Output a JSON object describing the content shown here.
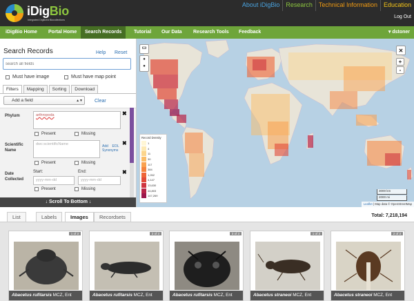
{
  "brand": {
    "name_white": "iDig",
    "name_green": "Bio",
    "tagline": "Integrated Digitized Biocollections"
  },
  "toplinks": [
    {
      "label": "About iDigBio",
      "color": "#4aa3df"
    },
    {
      "label": "Research",
      "color": "#8dc63f"
    },
    {
      "label": "Technical Information",
      "color": "#f39c12"
    },
    {
      "label": "Education",
      "color": "#f5c518"
    }
  ],
  "logout": "Log Out",
  "nav": {
    "items": [
      "iDigBio Home",
      "Portal Home",
      "Search Records",
      "Tutorial",
      "Our Data",
      "Research Tools",
      "Feedback"
    ],
    "active": "Search Records",
    "user": "▾ dstoner"
  },
  "search": {
    "title": "Search Records",
    "help": "Help",
    "reset": "Reset",
    "all_fields_placeholder": "search all fields",
    "must_have_image": "Must have image",
    "must_have_map_point": "Must have map point",
    "tabs": [
      "Filters",
      "Mapping",
      "Sorting",
      "Download"
    ],
    "active_tab": "Filters",
    "add_field": "Add a field",
    "clear": "Clear",
    "phylum": {
      "label": "Phylum",
      "value": "arthropoda",
      "present": "Present",
      "missing": "Missing"
    },
    "sci_name": {
      "label_1": "Scientific",
      "label_2": "Name",
      "placeholder": "dwc:scientificName",
      "add": "Add",
      "eol": "EOL",
      "synonyms": "Synonyms",
      "present": "Present",
      "missing": "Missing"
    },
    "date": {
      "label_1": "Date",
      "label_2": "Collected",
      "start": "Start:",
      "end": "End:",
      "placeholder": "yyyy-mm-dd",
      "present": "Present",
      "missing": "Missing"
    },
    "scroll_bottom": "↓ Scroll To Bottom ↓"
  },
  "map": {
    "zoom_in": "+",
    "zoom_out": "-",
    "close": "✕",
    "legend_title": "Record Density",
    "legend": [
      {
        "label": "1",
        "color": "#fff6d5"
      },
      {
        "label": "4",
        "color": "#fde9b3"
      },
      {
        "label": "11",
        "color": "#fcd58c"
      },
      {
        "label": "30",
        "color": "#fbbd68"
      },
      {
        "label": "117",
        "color": "#f9a14f"
      },
      {
        "label": "384",
        "color": "#f5833e"
      },
      {
        "label": "1,262",
        "color": "#ee6437"
      },
      {
        "label": "4,147",
        "color": "#e14a39"
      },
      {
        "label": "13,630",
        "color": "#cf3540"
      },
      {
        "label": "44,803",
        "color": "#b82548"
      },
      {
        "label": "147,269",
        "color": "#9c184c"
      }
    ],
    "scale_km": "3000 km",
    "scale_mi": "2000 mi",
    "leaflet": "Leaflet",
    "attribution": " | Map data © OpenStreetMap"
  },
  "results": {
    "tabs": [
      "List",
      "Labels",
      "Images",
      "Recordsets"
    ],
    "active_tab": "Images",
    "total": "Total: 7,218,194",
    "cards": [
      {
        "badge": "1 of 3",
        "species": "Abacetus rufitarsis",
        "inst": "MCZ, Ent"
      },
      {
        "badge": "2 of 3",
        "species": "Abacetus rufitarsis",
        "inst": "MCZ, Ent"
      },
      {
        "badge": "3 of 3",
        "species": "Abacetus rufitarsis",
        "inst": "MCZ, Ent"
      },
      {
        "badge": "1 of 3",
        "species": "Abacetus straneoi",
        "inst": "MCZ, Ent"
      },
      {
        "badge": "2 of 3",
        "species": "Abacetus straneoi",
        "inst": "MCZ, Ent"
      }
    ]
  }
}
